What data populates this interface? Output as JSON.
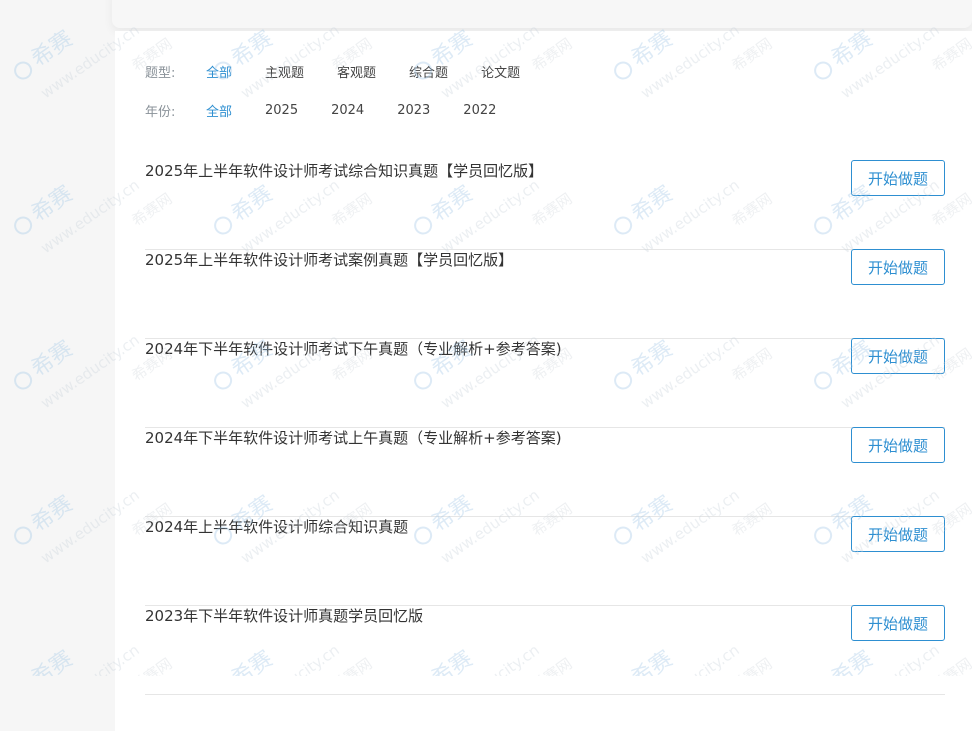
{
  "filters": {
    "type_label": "题型:",
    "type_options": [
      "全部",
      "主观题",
      "客观题",
      "综合题",
      "论文题"
    ],
    "year_label": "年份:",
    "year_options": [
      "全部",
      "2025",
      "2024",
      "2023",
      "2022"
    ],
    "active_color": "#2e8fd1"
  },
  "exams": [
    {
      "title": "2025年上半年软件设计师考试综合知识真题【学员回忆版】",
      "button": "开始做题"
    },
    {
      "title": "2025年上半年软件设计师考试案例真题【学员回忆版】",
      "button": "开始做题"
    },
    {
      "title": "2024年下半年软件设计师考试下午真题（专业解析+参考答案)",
      "button": "开始做题"
    },
    {
      "title": "2024年下半年软件设计师考试上午真题（专业解析+参考答案)",
      "button": "开始做题"
    },
    {
      "title": "2024年上半年软件设计师综合知识真题",
      "button": "开始做题"
    },
    {
      "title": "2023年下半年软件设计师真题学员回忆版",
      "button": "开始做题"
    }
  ],
  "watermark": {
    "brand": "希赛",
    "url": "www.educity.cn",
    "net": "希赛网"
  }
}
